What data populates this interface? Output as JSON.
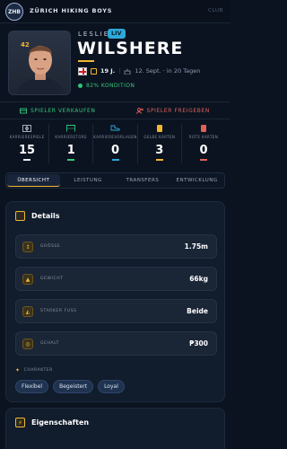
{
  "club": {
    "logo_text": "ZHB",
    "name": "ZÜRICH HIKING BOYS",
    "right_label": "CLUB"
  },
  "player": {
    "rating": "42",
    "first_name": "LESLIE",
    "badge": "LIV",
    "last_name": "WILSHERE",
    "age": "19 J.",
    "birthday": "12. Sept. · in 20 Tagen",
    "fitness": "82% KONDITION"
  },
  "actions": {
    "sell": "SPIELER VERKAUFEN",
    "release": "SPIELER FREIGEBEN"
  },
  "stats": [
    {
      "label": "KARRIERESPIELE",
      "value": "15",
      "color": "#e8edf4"
    },
    {
      "label": "KARRIERETORE",
      "value": "1",
      "color": "#34c77b"
    },
    {
      "label": "KARRIEREVORLAGEN",
      "value": "0",
      "color": "#2ea8d8"
    },
    {
      "label": "GELBE KARTEN",
      "value": "3",
      "color": "#f2b731"
    },
    {
      "label": "ROTE KARTEN",
      "value": "0",
      "color": "#e0605a"
    }
  ],
  "tabs": [
    "ÜBERSICHT",
    "LEISTUNG",
    "TRANSFERS",
    "ENTWICKLUNG"
  ],
  "details": {
    "title": "Details",
    "rows": [
      {
        "label": "GRÖSSE",
        "value": "1.75m",
        "icon": "height-icon"
      },
      {
        "label": "GEWICHT",
        "value": "66kg",
        "icon": "weight-icon"
      },
      {
        "label": "STARKER FUSS",
        "value": "Beide",
        "icon": "foot-icon"
      },
      {
        "label": "GEHALT",
        "value": "₱300",
        "icon": "salary-icon"
      }
    ],
    "character_label": "CHARAKTER",
    "traits": [
      "Flexibel",
      "Begeistert",
      "Loyal"
    ]
  },
  "properties": {
    "title": "Eigenschaften"
  }
}
